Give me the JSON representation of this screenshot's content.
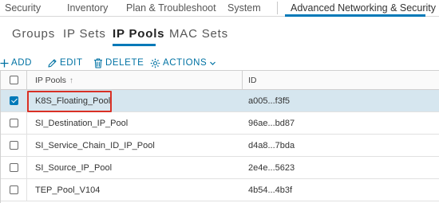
{
  "top_tabs": [
    {
      "label": "Security"
    },
    {
      "label": "Inventory"
    },
    {
      "label": "Plan & Troubleshoot"
    },
    {
      "label": "System"
    },
    {
      "label": "Advanced Networking & Security"
    }
  ],
  "sub_tabs": [
    {
      "label": "Groups"
    },
    {
      "label": "IP Sets"
    },
    {
      "label": "IP Pools"
    },
    {
      "label": "MAC Sets"
    }
  ],
  "toolbar": {
    "add_label": "ADD",
    "edit_label": "EDIT",
    "delete_label": "DELETE",
    "actions_label": "ACTIONS"
  },
  "table": {
    "columns": [
      "IP Pools",
      "ID"
    ],
    "sort_indicator": "↑",
    "rows": [
      {
        "name": "K8S_Floating_Pool",
        "id": "a005...f3f5",
        "selected": true
      },
      {
        "name": "SI_Destination_IP_Pool",
        "id": "96ae...bd87",
        "selected": false
      },
      {
        "name": "SI_Service_Chain_ID_IP_Pool",
        "id": "d4a8...7bda",
        "selected": false
      },
      {
        "name": "SI_Source_IP_Pool",
        "id": "2e4e...5623",
        "selected": false
      },
      {
        "name": "TEP_Pool_V104",
        "id": "4b54...4b3f",
        "selected": false
      }
    ]
  },
  "colors": {
    "accent": "#0079b8",
    "link": "#0072a3",
    "selected_row": "#d6e6ef",
    "highlight_box": "#d93025"
  }
}
